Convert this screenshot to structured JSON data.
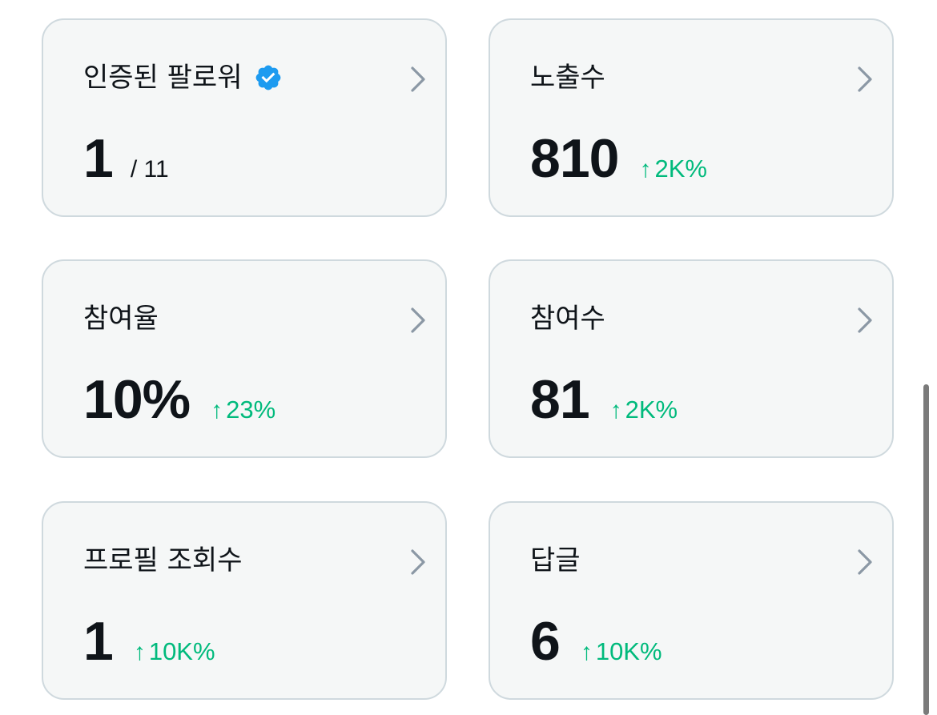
{
  "colors": {
    "card_background": "#f5f7f7",
    "card_border": "#cfd9de",
    "text": "#0f1419",
    "positive_change": "#00ba7c",
    "verified_badge": "#1d9bf0",
    "chevron": "#8b98a5"
  },
  "cards": [
    {
      "title": "인증된 팔로워",
      "icon": "verified-badge-icon",
      "value": "1",
      "denominator": "/ 11"
    },
    {
      "title": "노출수",
      "value": "810",
      "change": "2K%"
    },
    {
      "title": "참여율",
      "value": "10%",
      "change": "23%"
    },
    {
      "title": "참여수",
      "value": "81",
      "change": "2K%"
    },
    {
      "title": "프로필 조회수",
      "value": "1",
      "change": "10K%"
    },
    {
      "title": "답글",
      "value": "6",
      "change": "10K%"
    }
  ],
  "arrow_glyph": "↑"
}
